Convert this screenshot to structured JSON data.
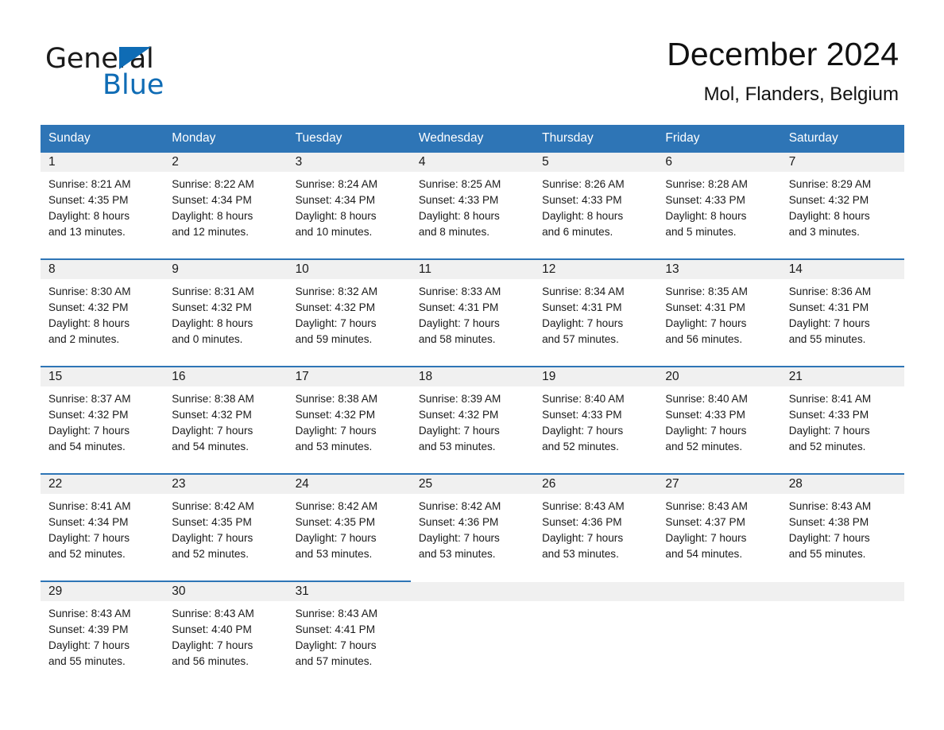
{
  "brand": {
    "name_part1": "General",
    "name_part2": "Blue",
    "logo_icon": "triangle-logo-icon",
    "accent_color": "#0f6cb5"
  },
  "header": {
    "title": "December 2024",
    "location": "Mol, Flanders, Belgium"
  },
  "theme": {
    "header_blue": "#2e75b6",
    "band_gray": "#f0f0f0",
    "text_color": "#1a1a1a"
  },
  "calendar": {
    "weekdays": [
      "Sunday",
      "Monday",
      "Tuesday",
      "Wednesday",
      "Thursday",
      "Friday",
      "Saturday"
    ],
    "weeks": [
      [
        {
          "day": "1",
          "sunrise": "Sunrise: 8:21 AM",
          "sunset": "Sunset: 4:35 PM",
          "daylight_line1": "Daylight: 8 hours",
          "daylight_line2": "and 13 minutes."
        },
        {
          "day": "2",
          "sunrise": "Sunrise: 8:22 AM",
          "sunset": "Sunset: 4:34 PM",
          "daylight_line1": "Daylight: 8 hours",
          "daylight_line2": "and 12 minutes."
        },
        {
          "day": "3",
          "sunrise": "Sunrise: 8:24 AM",
          "sunset": "Sunset: 4:34 PM",
          "daylight_line1": "Daylight: 8 hours",
          "daylight_line2": "and 10 minutes."
        },
        {
          "day": "4",
          "sunrise": "Sunrise: 8:25 AM",
          "sunset": "Sunset: 4:33 PM",
          "daylight_line1": "Daylight: 8 hours",
          "daylight_line2": "and 8 minutes."
        },
        {
          "day": "5",
          "sunrise": "Sunrise: 8:26 AM",
          "sunset": "Sunset: 4:33 PM",
          "daylight_line1": "Daylight: 8 hours",
          "daylight_line2": "and 6 minutes."
        },
        {
          "day": "6",
          "sunrise": "Sunrise: 8:28 AM",
          "sunset": "Sunset: 4:33 PM",
          "daylight_line1": "Daylight: 8 hours",
          "daylight_line2": "and 5 minutes."
        },
        {
          "day": "7",
          "sunrise": "Sunrise: 8:29 AM",
          "sunset": "Sunset: 4:32 PM",
          "daylight_line1": "Daylight: 8 hours",
          "daylight_line2": "and 3 minutes."
        }
      ],
      [
        {
          "day": "8",
          "sunrise": "Sunrise: 8:30 AM",
          "sunset": "Sunset: 4:32 PM",
          "daylight_line1": "Daylight: 8 hours",
          "daylight_line2": "and 2 minutes."
        },
        {
          "day": "9",
          "sunrise": "Sunrise: 8:31 AM",
          "sunset": "Sunset: 4:32 PM",
          "daylight_line1": "Daylight: 8 hours",
          "daylight_line2": "and 0 minutes."
        },
        {
          "day": "10",
          "sunrise": "Sunrise: 8:32 AM",
          "sunset": "Sunset: 4:32 PM",
          "daylight_line1": "Daylight: 7 hours",
          "daylight_line2": "and 59 minutes."
        },
        {
          "day": "11",
          "sunrise": "Sunrise: 8:33 AM",
          "sunset": "Sunset: 4:31 PM",
          "daylight_line1": "Daylight: 7 hours",
          "daylight_line2": "and 58 minutes."
        },
        {
          "day": "12",
          "sunrise": "Sunrise: 8:34 AM",
          "sunset": "Sunset: 4:31 PM",
          "daylight_line1": "Daylight: 7 hours",
          "daylight_line2": "and 57 minutes."
        },
        {
          "day": "13",
          "sunrise": "Sunrise: 8:35 AM",
          "sunset": "Sunset: 4:31 PM",
          "daylight_line1": "Daylight: 7 hours",
          "daylight_line2": "and 56 minutes."
        },
        {
          "day": "14",
          "sunrise": "Sunrise: 8:36 AM",
          "sunset": "Sunset: 4:31 PM",
          "daylight_line1": "Daylight: 7 hours",
          "daylight_line2": "and 55 minutes."
        }
      ],
      [
        {
          "day": "15",
          "sunrise": "Sunrise: 8:37 AM",
          "sunset": "Sunset: 4:32 PM",
          "daylight_line1": "Daylight: 7 hours",
          "daylight_line2": "and 54 minutes."
        },
        {
          "day": "16",
          "sunrise": "Sunrise: 8:38 AM",
          "sunset": "Sunset: 4:32 PM",
          "daylight_line1": "Daylight: 7 hours",
          "daylight_line2": "and 54 minutes."
        },
        {
          "day": "17",
          "sunrise": "Sunrise: 8:38 AM",
          "sunset": "Sunset: 4:32 PM",
          "daylight_line1": "Daylight: 7 hours",
          "daylight_line2": "and 53 minutes."
        },
        {
          "day": "18",
          "sunrise": "Sunrise: 8:39 AM",
          "sunset": "Sunset: 4:32 PM",
          "daylight_line1": "Daylight: 7 hours",
          "daylight_line2": "and 53 minutes."
        },
        {
          "day": "19",
          "sunrise": "Sunrise: 8:40 AM",
          "sunset": "Sunset: 4:33 PM",
          "daylight_line1": "Daylight: 7 hours",
          "daylight_line2": "and 52 minutes."
        },
        {
          "day": "20",
          "sunrise": "Sunrise: 8:40 AM",
          "sunset": "Sunset: 4:33 PM",
          "daylight_line1": "Daylight: 7 hours",
          "daylight_line2": "and 52 minutes."
        },
        {
          "day": "21",
          "sunrise": "Sunrise: 8:41 AM",
          "sunset": "Sunset: 4:33 PM",
          "daylight_line1": "Daylight: 7 hours",
          "daylight_line2": "and 52 minutes."
        }
      ],
      [
        {
          "day": "22",
          "sunrise": "Sunrise: 8:41 AM",
          "sunset": "Sunset: 4:34 PM",
          "daylight_line1": "Daylight: 7 hours",
          "daylight_line2": "and 52 minutes."
        },
        {
          "day": "23",
          "sunrise": "Sunrise: 8:42 AM",
          "sunset": "Sunset: 4:35 PM",
          "daylight_line1": "Daylight: 7 hours",
          "daylight_line2": "and 52 minutes."
        },
        {
          "day": "24",
          "sunrise": "Sunrise: 8:42 AM",
          "sunset": "Sunset: 4:35 PM",
          "daylight_line1": "Daylight: 7 hours",
          "daylight_line2": "and 53 minutes."
        },
        {
          "day": "25",
          "sunrise": "Sunrise: 8:42 AM",
          "sunset": "Sunset: 4:36 PM",
          "daylight_line1": "Daylight: 7 hours",
          "daylight_line2": "and 53 minutes."
        },
        {
          "day": "26",
          "sunrise": "Sunrise: 8:43 AM",
          "sunset": "Sunset: 4:36 PM",
          "daylight_line1": "Daylight: 7 hours",
          "daylight_line2": "and 53 minutes."
        },
        {
          "day": "27",
          "sunrise": "Sunrise: 8:43 AM",
          "sunset": "Sunset: 4:37 PM",
          "daylight_line1": "Daylight: 7 hours",
          "daylight_line2": "and 54 minutes."
        },
        {
          "day": "28",
          "sunrise": "Sunrise: 8:43 AM",
          "sunset": "Sunset: 4:38 PM",
          "daylight_line1": "Daylight: 7 hours",
          "daylight_line2": "and 55 minutes."
        }
      ],
      [
        {
          "day": "29",
          "sunrise": "Sunrise: 8:43 AM",
          "sunset": "Sunset: 4:39 PM",
          "daylight_line1": "Daylight: 7 hours",
          "daylight_line2": "and 55 minutes."
        },
        {
          "day": "30",
          "sunrise": "Sunrise: 8:43 AM",
          "sunset": "Sunset: 4:40 PM",
          "daylight_line1": "Daylight: 7 hours",
          "daylight_line2": "and 56 minutes."
        },
        {
          "day": "31",
          "sunrise": "Sunrise: 8:43 AM",
          "sunset": "Sunset: 4:41 PM",
          "daylight_line1": "Daylight: 7 hours",
          "daylight_line2": "and 57 minutes."
        },
        {
          "day": "",
          "sunrise": "",
          "sunset": "",
          "daylight_line1": "",
          "daylight_line2": ""
        },
        {
          "day": "",
          "sunrise": "",
          "sunset": "",
          "daylight_line1": "",
          "daylight_line2": ""
        },
        {
          "day": "",
          "sunrise": "",
          "sunset": "",
          "daylight_line1": "",
          "daylight_line2": ""
        },
        {
          "day": "",
          "sunrise": "",
          "sunset": "",
          "daylight_line1": "",
          "daylight_line2": ""
        }
      ]
    ]
  }
}
